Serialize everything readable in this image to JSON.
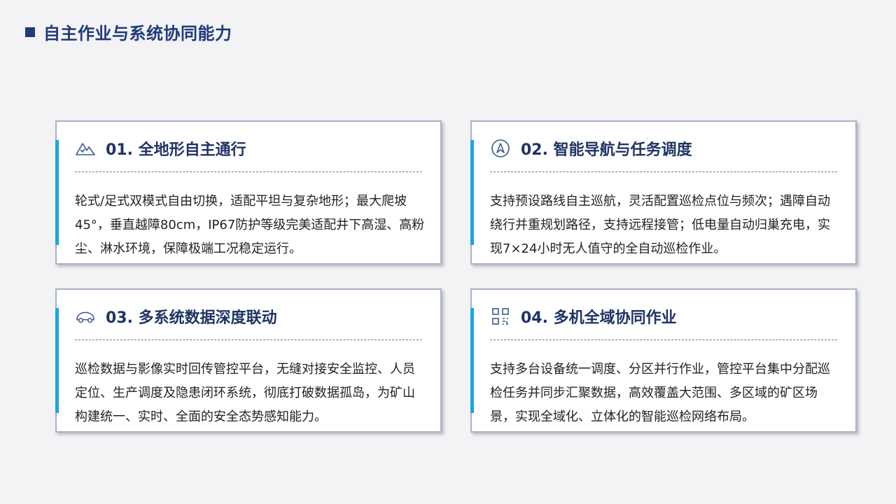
{
  "page": {
    "title": "自主作业与系统协同能力"
  },
  "colors": {
    "title": "#1f3a7a",
    "accent": "#1aa6e4",
    "card_border": "#a7b3cc",
    "heading": "#1f3466",
    "icon": "#3a5a8a"
  },
  "cards": [
    {
      "icon": "mountain-icon",
      "title": "01. 全地形自主通行",
      "body": "轮式/足式双模式自由切换，适配平坦与复杂地形；最大爬坡45°，垂直越障80cm，IP67防护等级完美适配井下高湿、高粉尘、淋水环境，保障极端工况稳定运行。"
    },
    {
      "icon": "navigation-icon",
      "title": "02. 智能导航与任务调度",
      "body": "支持预设路线自主巡航，灵活配置巡检点位与频次；遇障自动绕行并重规划路径，支持远程接管；低电量自动归巢充电，实现7×24小时无人值守的全自动巡检作业。"
    },
    {
      "icon": "vehicle-icon",
      "title": "03. 多系统数据深度联动",
      "body": "巡检数据与影像实时回传管控平台，无缝对接安全监控、人员定位、生产调度及隐患闭环系统，彻底打破数据孤岛，为矿山构建统一、实时、全面的安全态势感知能力。"
    },
    {
      "icon": "grid-icon",
      "title": "04. 多机全域协同作业",
      "body": "支持多台设备统一调度、分区并行作业，管控平台集中分配巡检任务并同步汇聚数据，高效覆盖大范围、多区域的矿区场景，实现全域化、立体化的智能巡检网络布局。"
    }
  ]
}
